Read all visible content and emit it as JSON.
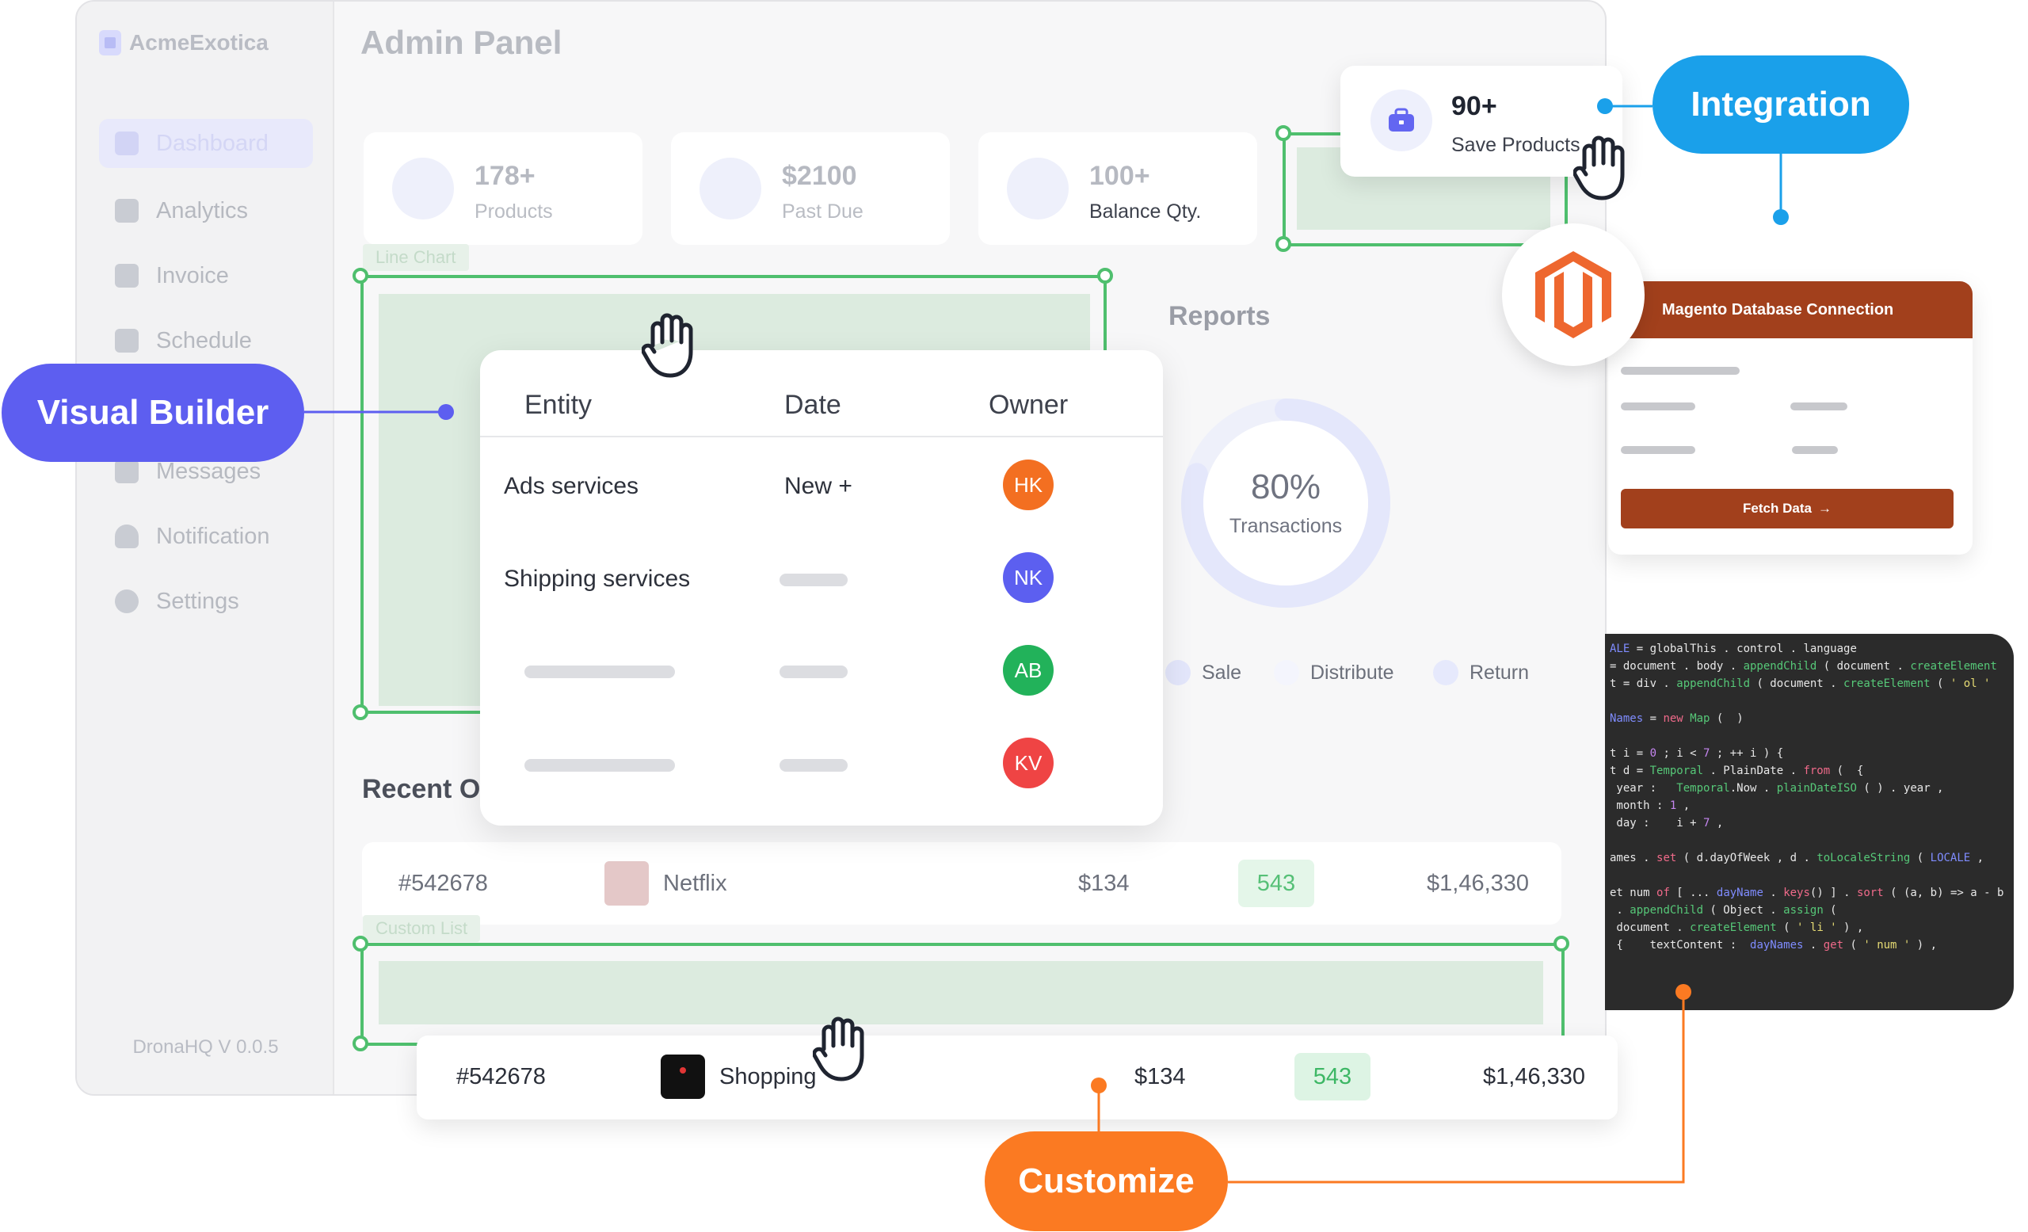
{
  "app": {
    "brand": "AcmeExotica",
    "title": "Admin Panel",
    "version": "DronaHQ V 0.0.5",
    "nav": [
      {
        "label": "Dashboard",
        "icon": "grid-icon",
        "active": true
      },
      {
        "label": "Analytics",
        "icon": "chart-icon",
        "active": false
      },
      {
        "label": "Invoice",
        "icon": "invoice-icon",
        "active": false
      },
      {
        "label": "Schedule",
        "icon": "calendar-icon",
        "active": false
      },
      {
        "label": "Messages",
        "icon": "message-icon",
        "active": false
      },
      {
        "label": "Notification",
        "icon": "bell-icon",
        "active": false
      },
      {
        "label": "Settings",
        "icon": "gear-icon",
        "active": false
      }
    ]
  },
  "stats": [
    {
      "value": "178+",
      "label": "Products"
    },
    {
      "value": "$2100",
      "label": "Past Due"
    },
    {
      "value": "100+",
      "label": "Balance Qty."
    }
  ],
  "widgets": {
    "line_chart_tag": "Line Chart",
    "custom_list_tag": "Custom List"
  },
  "reports": {
    "title": "Reports",
    "donut_value": "80%",
    "donut_fraction": 0.8,
    "donut_label": "Transactions",
    "legend": [
      {
        "label": "Sale",
        "color": "#e3e6fb"
      },
      {
        "label": "Distribute",
        "color": "#f4f5fd"
      },
      {
        "label": "Return",
        "color": "#e6e9fc"
      }
    ]
  },
  "recent": {
    "title": "Recent O",
    "rows": [
      {
        "id": "#542678",
        "name": "Netflix",
        "price": "$134",
        "qty": "543",
        "total": "$1,46,330"
      },
      {
        "id": "#542678",
        "name": "Shopping",
        "price": "$134",
        "qty": "543",
        "total": "$1,46,330"
      }
    ]
  },
  "entity_table": {
    "headers": [
      "Entity",
      "Date",
      "Owner"
    ],
    "rows": [
      {
        "entity": "Ads services",
        "date": "New +",
        "owner": "HK",
        "owner_color": "#f36f21"
      },
      {
        "entity": "Shipping services",
        "date": "",
        "owner": "NK",
        "owner_color": "#5c5ff0"
      },
      {
        "entity": "",
        "date": "",
        "owner": "AB",
        "owner_color": "#22b25a"
      },
      {
        "entity": "",
        "date": "",
        "owner": "KV",
        "owner_color": "#ef4444"
      }
    ]
  },
  "save_card": {
    "value": "90+",
    "label": "Save Products"
  },
  "magento": {
    "title": "Magento Database Connection",
    "button": "Fetch Data"
  },
  "code_lines": [
    "ALE = globalThis . control . language",
    "= document . body . appendChild ( document . createElement",
    "t = div . appendChild ( document . createElement ( ' ol '",
    "",
    "Names = new Map (  )",
    "",
    "t i = 0 ; i < 7 ; ++ i ) {",
    "t d = Temporal . PlainDate . from (  {",
    " year :   Temporal.Now . plainDateISO ( ) . year ,",
    " month : 1 ,",
    " day :    i + 7 ,",
    "",
    "ames . set ( d.dayOfWeek , d . toLocaleString ( LOCALE ,",
    "",
    "et num of [ ... dayName . keys() ] . sort ( (a, b) => a - b",
    " . appendChild ( Object . assign (",
    " document . createElement ( ' li ' ) ,",
    " {    textContent :  dayNames . get ( ' num ' ) ,"
  ],
  "labels": {
    "visual_builder": "Visual Builder",
    "integration": "Integration",
    "customize": "Customize"
  },
  "colors": {
    "visual_builder": "#5d5ef0",
    "integration": "#1aa0ea",
    "customize": "#fb7a22",
    "selection": "#4fbf6e",
    "magento": "#a2401c"
  }
}
